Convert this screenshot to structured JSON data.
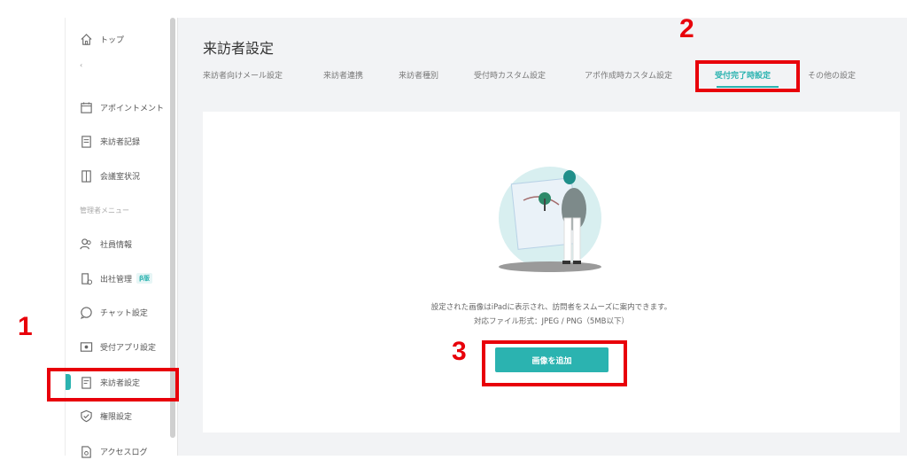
{
  "sidebar": {
    "items": [
      {
        "label": "トップ",
        "icon": "home-icon"
      },
      {
        "label": "アポイントメント",
        "icon": "calendar-icon"
      },
      {
        "label": "来訪者記録",
        "icon": "clipboard-icon"
      },
      {
        "label": "会議室状況",
        "icon": "door-icon"
      },
      {
        "label": "社員情報",
        "icon": "users-icon"
      },
      {
        "label": "出社管理",
        "icon": "building-icon",
        "badge": "β版"
      },
      {
        "label": "チャット設定",
        "icon": "chat-icon"
      },
      {
        "label": "受付アプリ設定",
        "icon": "tablet-icon"
      },
      {
        "label": "来訪者設定",
        "icon": "visitor-card-icon",
        "active": true
      },
      {
        "label": "権限設定",
        "icon": "shield-check-icon"
      },
      {
        "label": "アクセスログ",
        "icon": "log-icon"
      }
    ],
    "collapse_label": "‹",
    "section_caption": "管理者メニュー"
  },
  "main": {
    "title": "来訪者設定",
    "tabs": [
      {
        "label": "来訪者向けメール設定"
      },
      {
        "label": "来訪者連携"
      },
      {
        "label": "来訪者種別"
      },
      {
        "label": "受付時カスタム設定"
      },
      {
        "label": "アポ作成時カスタム設定"
      },
      {
        "label": "受付完了時設定",
        "active": true
      },
      {
        "label": "その他の設定"
      }
    ],
    "description_line1": "設定された画像はiPadに表示され、訪問者をスムーズに案内できます。",
    "description_line2": "対応ファイル形式：JPEG / PNG（5MB以下）",
    "add_image_button": "画像を追加"
  },
  "annotations": {
    "step1": "1",
    "step2": "2",
    "step3": "3",
    "color": "#e8000a"
  },
  "colors": {
    "accent": "#2bb3b0",
    "main_bg": "#f2f3f5"
  }
}
